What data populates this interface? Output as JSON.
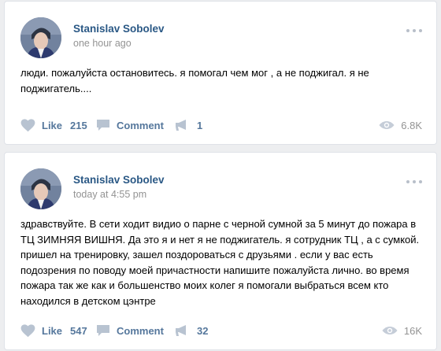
{
  "posts": [
    {
      "author": "Stanislav Sobolev",
      "time": "one hour ago",
      "text": "люди. пожалуйста остановитесь. я помогал чем мог , а не поджигал. я не поджигатель....",
      "like_label": "Like",
      "like_count": "215",
      "comment_label": "Comment",
      "share_count": "1",
      "views": "6.8K"
    },
    {
      "author": "Stanislav Sobolev",
      "time": "today at 4:55 pm",
      "text": "здравствуйте. В сети ходит видио о парне с черной сумной за 5 минут до пожара в ТЦ ЗИМНЯЯ ВИШНЯ. Да это я и нет я не поджигатель. я сотрудник ТЦ , а с сумкой. пришел на тренировку, зашел поздороваться с друзьями . если у вас есть подозрения по поводу моей причастности напишите пожалуйста лично. во время пожара так же как и большенство моих колег я помогали выбраться всем кто находился в детском цэнтре",
      "like_label": "Like",
      "like_count": "547",
      "comment_label": "Comment",
      "share_count": "32",
      "views": "16K"
    }
  ],
  "icons": {
    "like": "heart-icon",
    "comment": "comment-bubble-icon",
    "share": "megaphone-icon",
    "views": "eye-icon",
    "menu": "more-dots-icon"
  },
  "colors": {
    "author_link": "#2a5885",
    "action": "#55779c",
    "icon": "#b8c3d1",
    "muted": "#939393",
    "background": "#edeef0"
  }
}
